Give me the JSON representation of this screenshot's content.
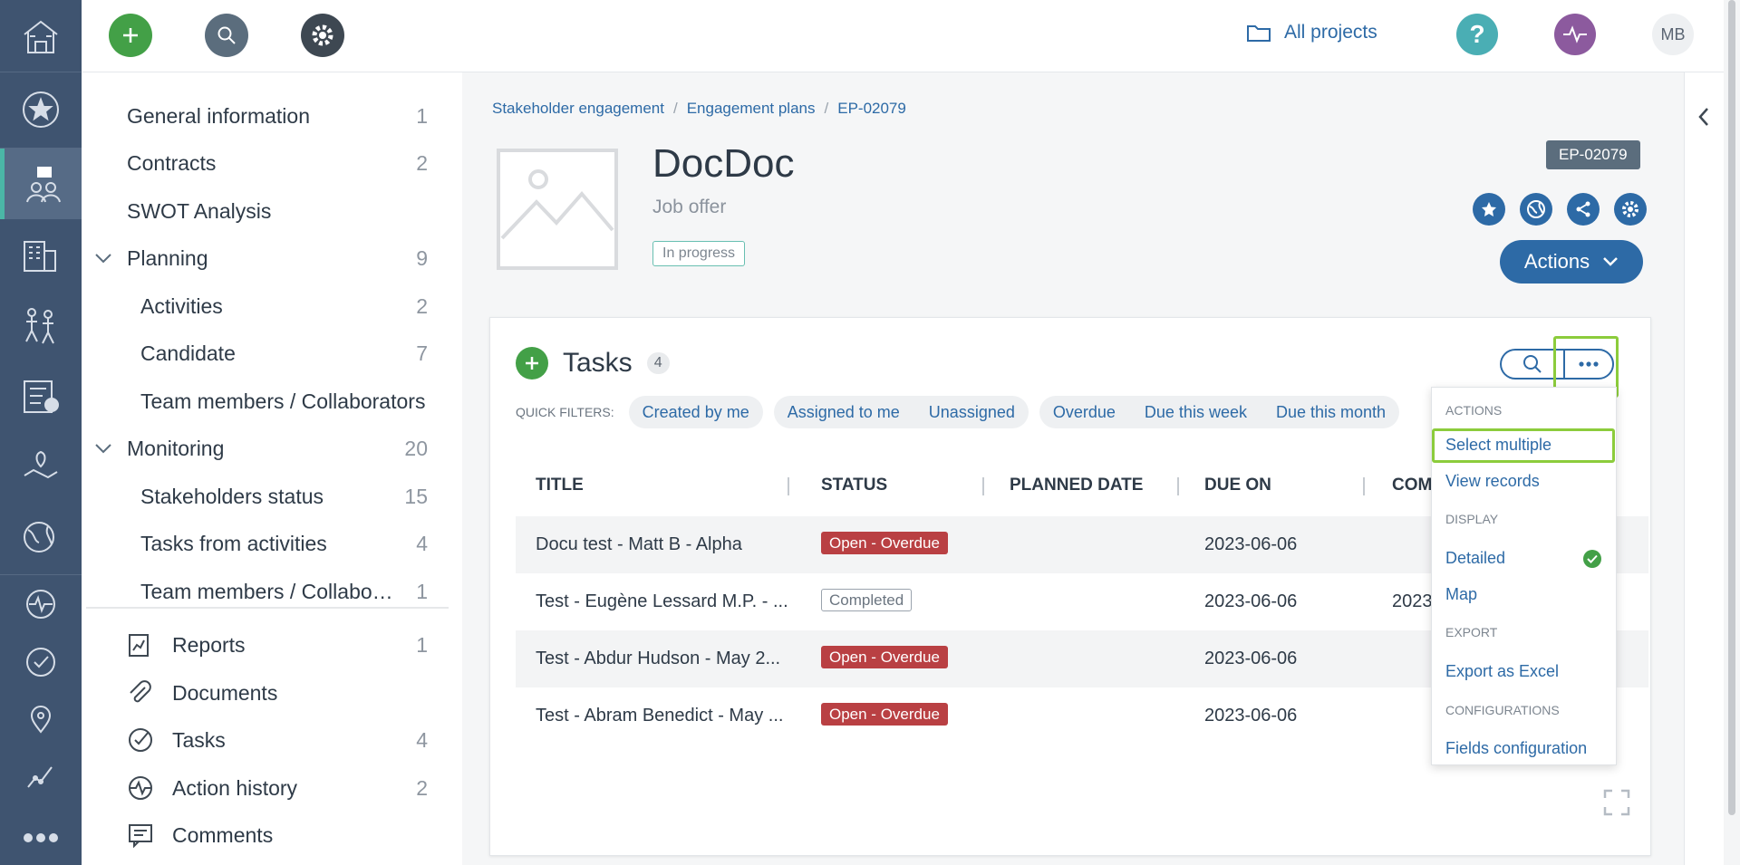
{
  "topbar": {
    "all_projects": "All projects",
    "avatar_initials": "MB",
    "colors": {
      "add": "#43a047",
      "search": "#5b6d7d",
      "settings": "#3e4852",
      "help": "#4aaeb4",
      "pulse": "#8c5a9e"
    }
  },
  "rail": {
    "icons": [
      "home-icon",
      "star-icon",
      "stakeholder-icon",
      "building-icon",
      "people-icon",
      "checklist-icon",
      "map-pin-icon",
      "globe-leaf-icon",
      "pulse-icon",
      "check-circle-icon",
      "location-icon",
      "chart-line-icon",
      "more-icon"
    ]
  },
  "nav": {
    "items": [
      {
        "label": "General information",
        "count": "1"
      },
      {
        "label": "Contracts",
        "count": "2"
      },
      {
        "label": "SWOT Analysis",
        "count": ""
      },
      {
        "label": "Planning",
        "count": "9"
      },
      {
        "label": "Activities",
        "count": "2"
      },
      {
        "label": "Candidate",
        "count": "7"
      },
      {
        "label": "Team members / Collaborators",
        "count": ""
      },
      {
        "label": "Monitoring",
        "count": "20"
      },
      {
        "label": "Stakeholders status",
        "count": "15"
      },
      {
        "label": "Tasks from activities",
        "count": "4"
      },
      {
        "label": "Team members / Collaborators",
        "count": "1"
      },
      {
        "label": "Reports",
        "count": "1"
      },
      {
        "label": "Documents",
        "count": ""
      },
      {
        "label": "Tasks",
        "count": "4"
      },
      {
        "label": "Action history",
        "count": "2"
      },
      {
        "label": "Comments",
        "count": ""
      }
    ]
  },
  "breadcrumb": [
    "Stakeholder engagement",
    "Engagement plans",
    "EP-02079"
  ],
  "record": {
    "title": "DocDoc",
    "subtitle": "Job offer",
    "status": "In progress",
    "code": "EP-02079",
    "actions_label": "Actions"
  },
  "tasks": {
    "title": "Tasks",
    "count": "4",
    "quick_filters_label": "QUICK FILTERS:",
    "filter_groups": [
      [
        "Created by me"
      ],
      [
        "Assigned to me",
        "Unassigned"
      ],
      [
        "Overdue",
        "Due this week",
        "Due this month"
      ]
    ],
    "columns": [
      "TITLE",
      "STATUS",
      "PLANNED DATE",
      "DUE ON",
      "COM"
    ],
    "rows": [
      {
        "title": "Docu test - Matt B - Alpha",
        "status": "Open - Overdue",
        "planned": "",
        "due": "2023-06-06",
        "completed": ""
      },
      {
        "title": "Test - Eugène Lessard M.P. - ...",
        "status": "Completed",
        "planned": "",
        "due": "2023-06-06",
        "completed": "2023"
      },
      {
        "title": "Test - Abdur Hudson - May 2...",
        "status": "Open - Overdue",
        "planned": "",
        "due": "2023-06-06",
        "completed": ""
      },
      {
        "title": "Test - Abram Benedict - May ...",
        "status": "Open - Overdue",
        "planned": "",
        "due": "2023-06-06",
        "completed": ""
      }
    ]
  },
  "menu": {
    "actions_header": "ACTIONS",
    "select_multiple": "Select multiple",
    "view_records": "View records",
    "display_header": "DISPLAY",
    "detailed": "Detailed",
    "map": "Map",
    "export_header": "EXPORT",
    "export_excel": "Export as Excel",
    "config_header": "CONFIGURATIONS",
    "fields_config": "Fields configuration"
  }
}
